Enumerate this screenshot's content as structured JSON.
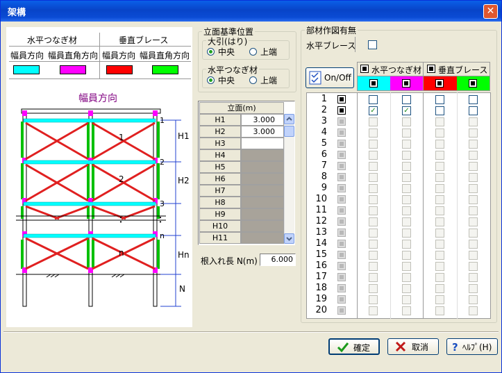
{
  "window": {
    "title": "架構",
    "close_glyph": "✕"
  },
  "legend": {
    "group_horizontal": "水平つなぎ材",
    "group_brace": "垂直ブレース",
    "col_width": "幅員方向",
    "col_perp": "幅員直角方向",
    "colors": {
      "cyan": "#00ffff",
      "magenta": "#ff00ff",
      "red": "#ff0000",
      "green": "#00ff00"
    }
  },
  "diagram": {
    "title": "幅員方向",
    "level_labels": [
      "1",
      "2",
      "3",
      "n"
    ],
    "bay_labels": [
      "1",
      "2",
      "n"
    ],
    "dots": "：",
    "dim_labels": [
      "H1",
      "H2",
      "Hn",
      "N"
    ]
  },
  "elevation_ref": {
    "group_label": "立面基準位置",
    "ohiki_label": "大引(はり)",
    "ohiki_center": "中央",
    "ohiki_top": "上端",
    "hz_label": "水平つなぎ材",
    "hz_center": "中央",
    "hz_top": "上端"
  },
  "height_table": {
    "header": "立面(m)",
    "rows": [
      {
        "name": "H1",
        "value": "3.000"
      },
      {
        "name": "H2",
        "value": "3.000"
      },
      {
        "name": "H3",
        "value": ""
      },
      {
        "name": "H4",
        "value": ""
      },
      {
        "name": "H5",
        "value": ""
      },
      {
        "name": "H6",
        "value": ""
      },
      {
        "name": "H7",
        "value": ""
      },
      {
        "name": "H8",
        "value": ""
      },
      {
        "name": "H9",
        "value": ""
      },
      {
        "name": "H10",
        "value": ""
      },
      {
        "name": "H11",
        "value": ""
      }
    ]
  },
  "embed": {
    "label": "根入れ長 N(m)",
    "value": "6.000"
  },
  "members": {
    "group_label": "部材作図有無",
    "horizontal_brace_label": "水平ブレース",
    "onoff_label": "On/Off",
    "col_horizontal": "水平つなぎ材",
    "col_brace": "垂直ブレース",
    "rows": [
      "1",
      "2",
      "3",
      "4",
      "5",
      "6",
      "7",
      "8",
      "9",
      "10",
      "11",
      "12",
      "13",
      "14",
      "15",
      "16",
      "17",
      "18",
      "19",
      "20"
    ]
  },
  "buttons": {
    "ok": "確定",
    "cancel": "取消",
    "help": "ﾍﾙﾌﾟ(H)"
  }
}
